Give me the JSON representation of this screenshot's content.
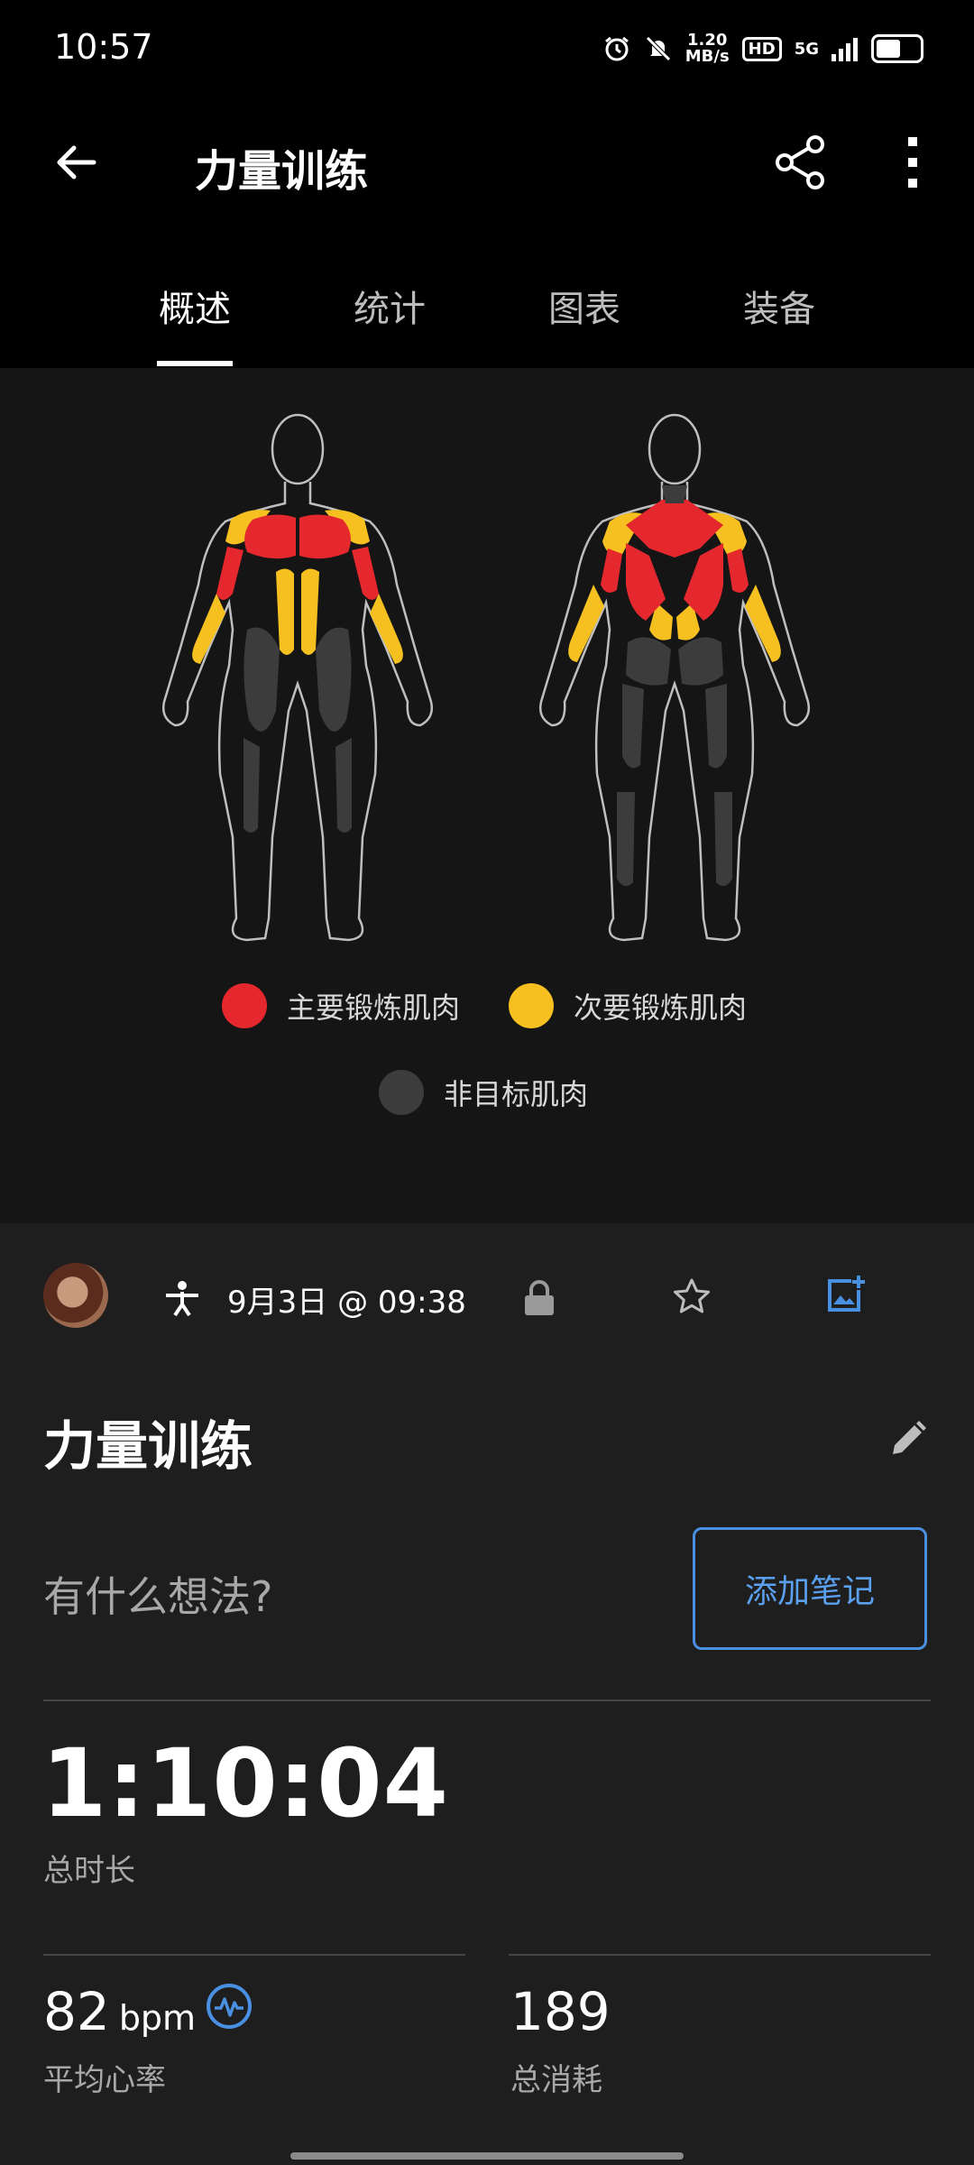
{
  "status_bar": {
    "time": "10:57",
    "net_speed_value": "1.20",
    "net_speed_unit": "MB/s",
    "hd_badge": "HD",
    "network": "5G"
  },
  "header": {
    "title": "力量训练"
  },
  "tabs": [
    {
      "label": "概述",
      "active": true
    },
    {
      "label": "统计",
      "active": false
    },
    {
      "label": "图表",
      "active": false
    },
    {
      "label": "装备",
      "active": false
    }
  ],
  "muscle_map": {
    "legend": {
      "primary": {
        "label": "主要锻炼肌肉",
        "color": "#e5282e"
      },
      "secondary": {
        "label": "次要锻炼肌肉",
        "color": "#f5c020"
      },
      "untargeted": {
        "label": "非目标肌肉",
        "color": "#3c3c3c"
      }
    }
  },
  "workout": {
    "date": "9月3日 @ 09:38",
    "title": "力量训练",
    "thoughts_placeholder": "有什么想法?",
    "add_note_label": "添加笔记",
    "duration_value": "1:10:04",
    "duration_label": "总时长",
    "avg_hr_value": "82",
    "avg_hr_unit": "bpm",
    "avg_hr_label": "平均心率",
    "calories_value": "189",
    "calories_label": "总消耗"
  },
  "colors": {
    "accent": "#4a90e2",
    "primary_muscle": "#e5282e",
    "secondary_muscle": "#f5c020"
  }
}
